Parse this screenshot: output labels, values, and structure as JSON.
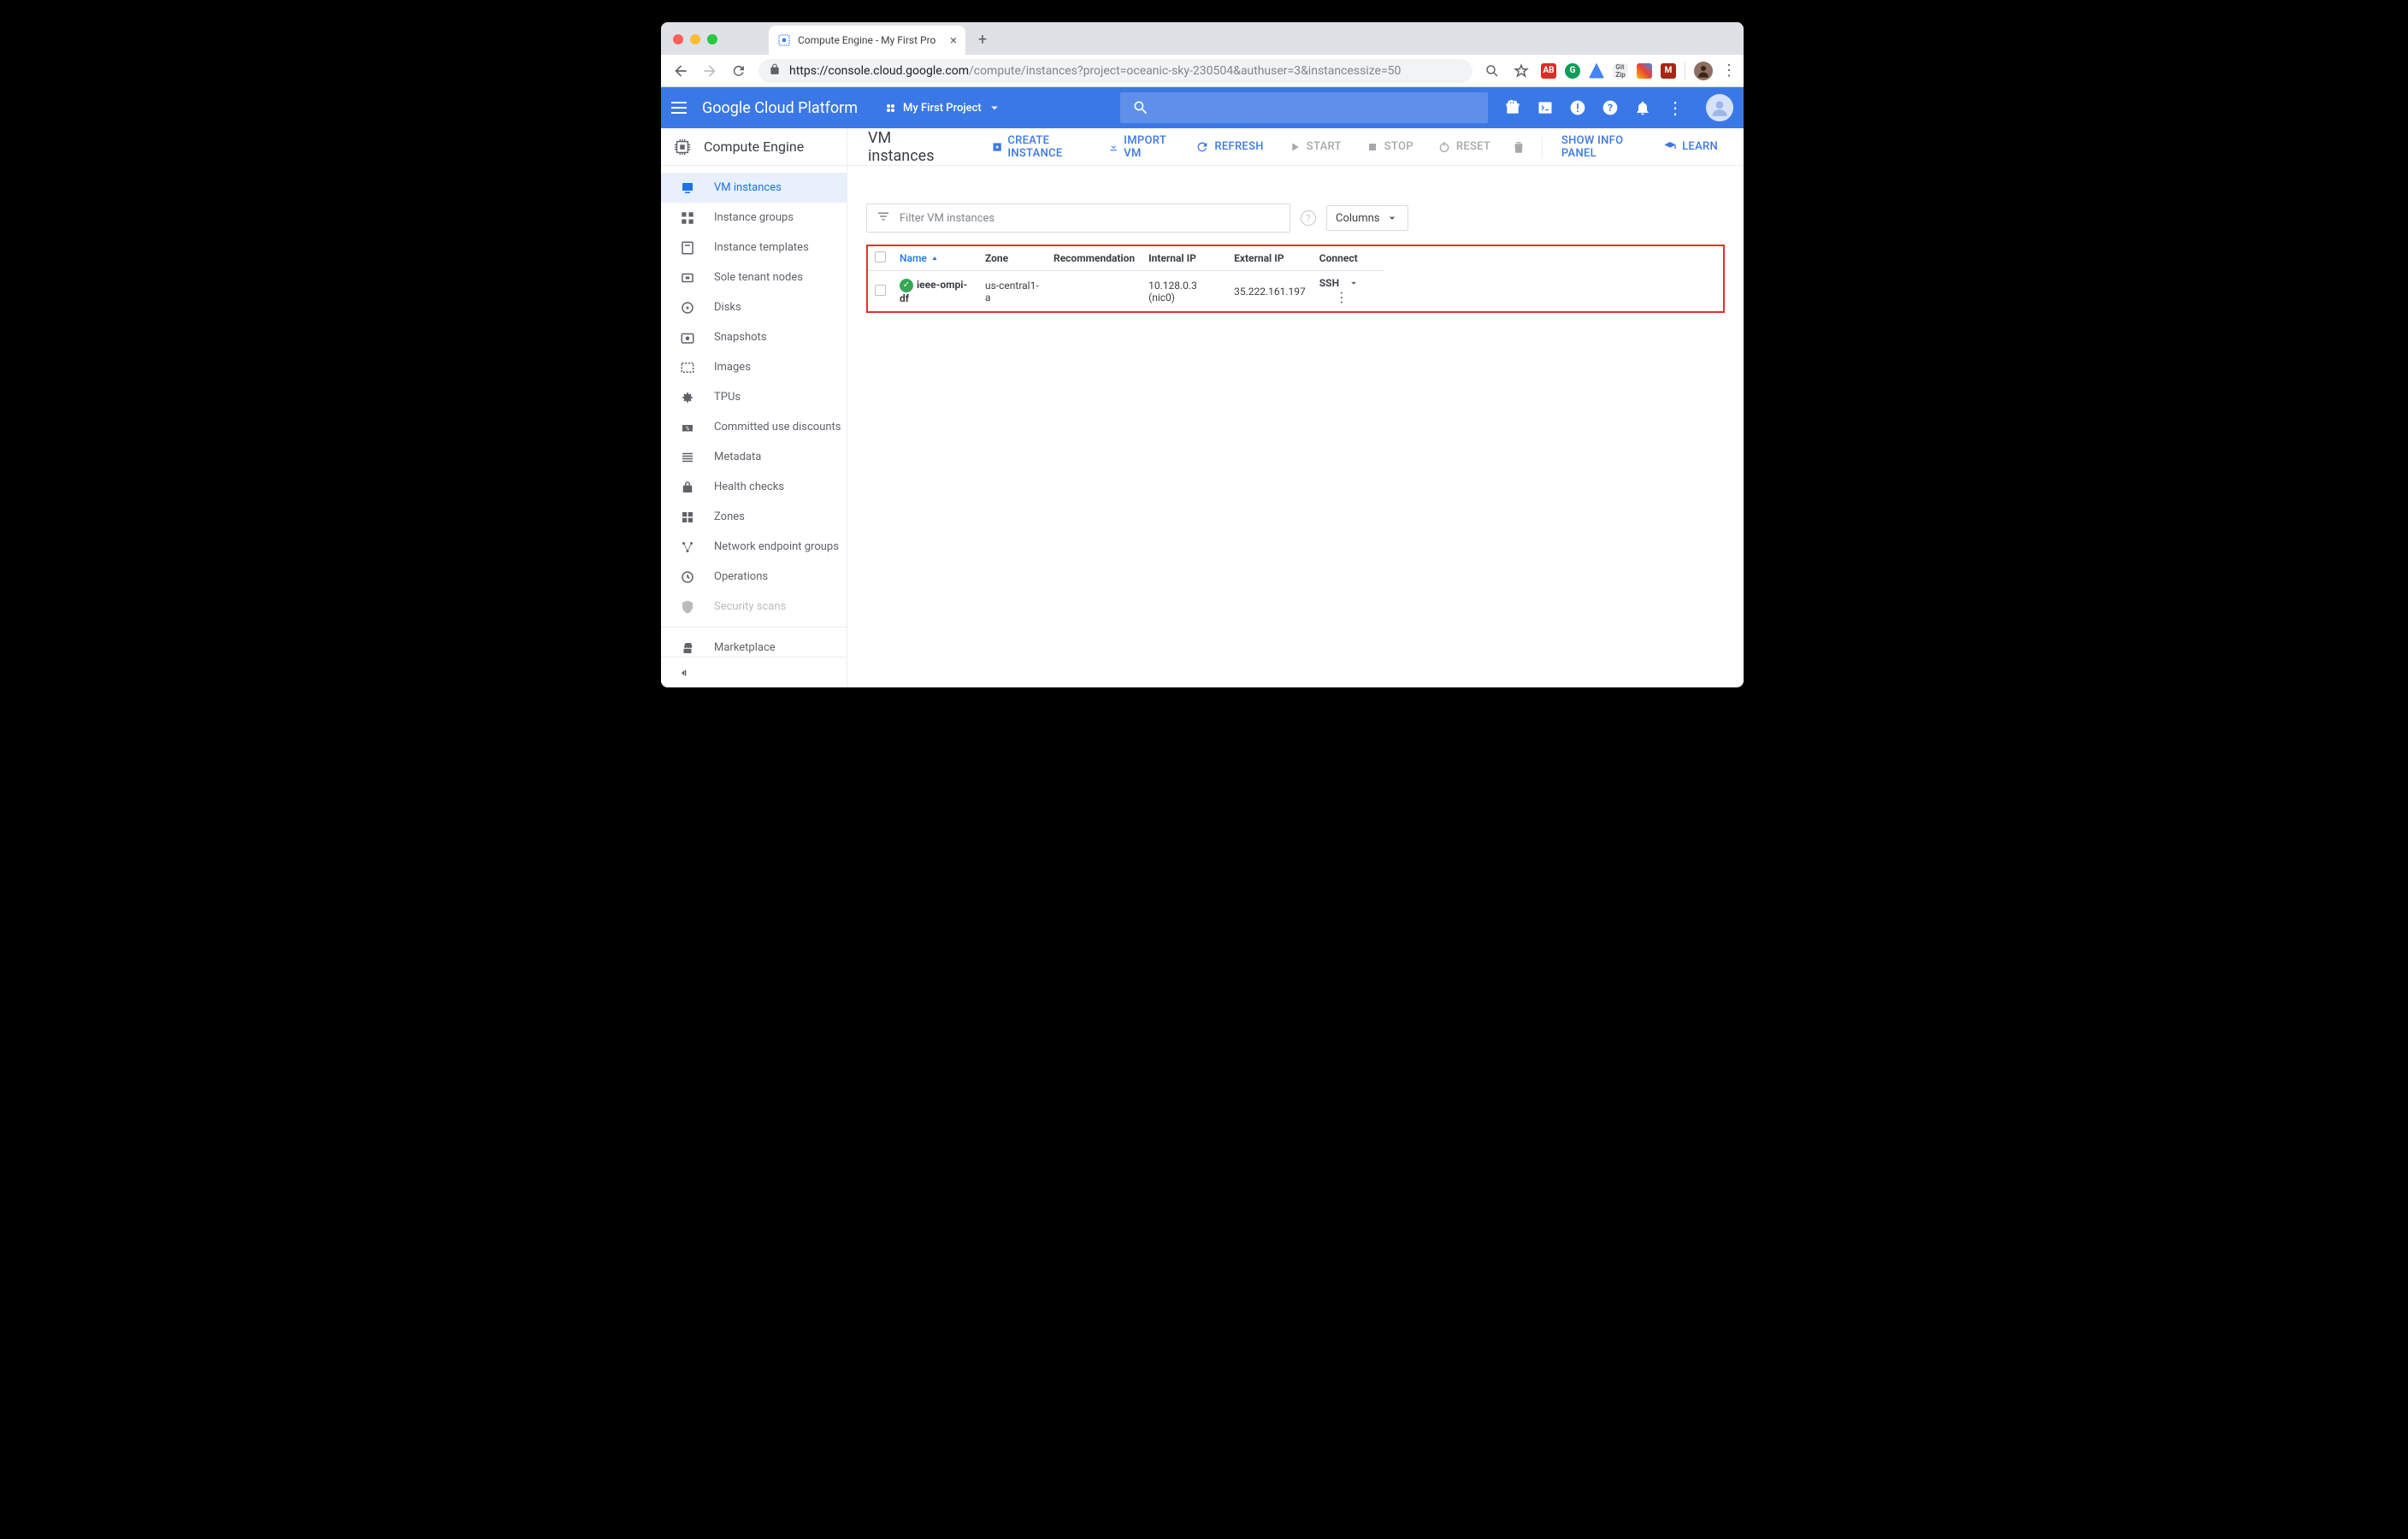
{
  "browser": {
    "tab_title": "Compute Engine - My First Pro",
    "url_host": "https://console.cloud.google.com",
    "url_path": "/compute/instances?project=oceanic-sky-230504&authuser=3&instancessize=50"
  },
  "header": {
    "platform": "Google Cloud Platform",
    "project": "My First Project"
  },
  "sidebar": {
    "title": "Compute Engine",
    "items": [
      {
        "label": "VM instances",
        "active": true
      },
      {
        "label": "Instance groups"
      },
      {
        "label": "Instance templates"
      },
      {
        "label": "Sole tenant nodes"
      },
      {
        "label": "Disks"
      },
      {
        "label": "Snapshots"
      },
      {
        "label": "Images"
      },
      {
        "label": "TPUs"
      },
      {
        "label": "Committed use discounts"
      },
      {
        "label": "Metadata"
      },
      {
        "label": "Health checks"
      },
      {
        "label": "Zones"
      },
      {
        "label": "Network endpoint groups"
      },
      {
        "label": "Operations"
      },
      {
        "label": "Security scans"
      }
    ],
    "marketplace": "Marketplace"
  },
  "actionbar": {
    "page_title": "VM instances",
    "create": "CREATE INSTANCE",
    "import": "IMPORT VM",
    "refresh": "REFRESH",
    "start": "START",
    "stop": "STOP",
    "reset": "RESET",
    "info_panel": "SHOW INFO PANEL",
    "learn": "LEARN"
  },
  "filter": {
    "placeholder": "Filter VM instances",
    "columns_label": "Columns"
  },
  "table": {
    "headers": {
      "name": "Name",
      "zone": "Zone",
      "recommendation": "Recommendation",
      "internal_ip": "Internal IP",
      "external_ip": "External IP",
      "connect": "Connect"
    },
    "rows": [
      {
        "name": "ieee-ompi-df",
        "zone": "us-central1-a",
        "recommendation": "",
        "internal_ip": "10.128.0.3 (nic0)",
        "external_ip": "35.222.161.197",
        "connect": "SSH"
      }
    ]
  }
}
